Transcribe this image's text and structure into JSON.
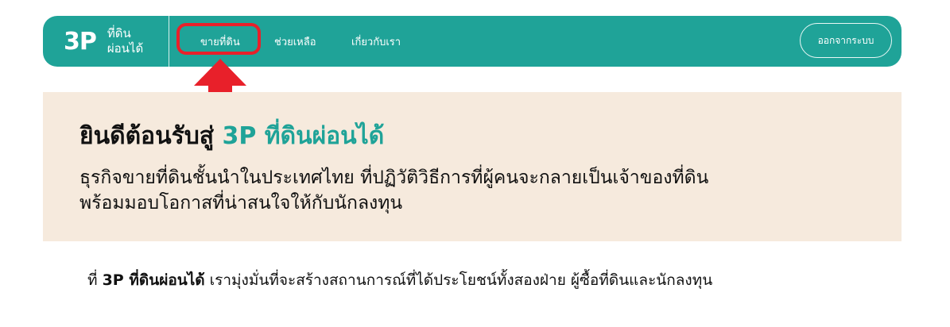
{
  "nav": {
    "logo_mark": "3P",
    "logo_text_1": "ที่ดิน",
    "logo_text_2": "ผ่อนได้",
    "items": [
      "ขายที่ดิน",
      "ช่วยเหลือ",
      "เกี่ยวกับเรา"
    ],
    "logout": "ออกจากระบบ"
  },
  "hero": {
    "title_prefix": "ยินดีต้อนรับสู่ ",
    "title_brand": "3P ที่ดินผ่อนได้",
    "line1": "ธุรกิจขายที่ดินชั้นนำในประเทศไทย ที่ปฏิวัติวิธีการที่ผู้คนจะกลายเป็นเจ้าของที่ดิน",
    "line2": "พร้อมมอบโอกาสที่น่าสนใจให้กับนักลงทุน"
  },
  "intro": {
    "prefix": "ที่ ",
    "brand": "3P ที่ดินผ่อนได้",
    "text": " เรามุ่งมั่นที่จะสร้างสถานการณ์ที่ได้ประโยชน์ทั้งสองฝ่าย ผู้ซื้อที่ดินและนักลงทุน"
  },
  "colors": {
    "brand": "#1fa398",
    "hero_bg": "#f6eadd",
    "annotation": "#e8202a"
  }
}
